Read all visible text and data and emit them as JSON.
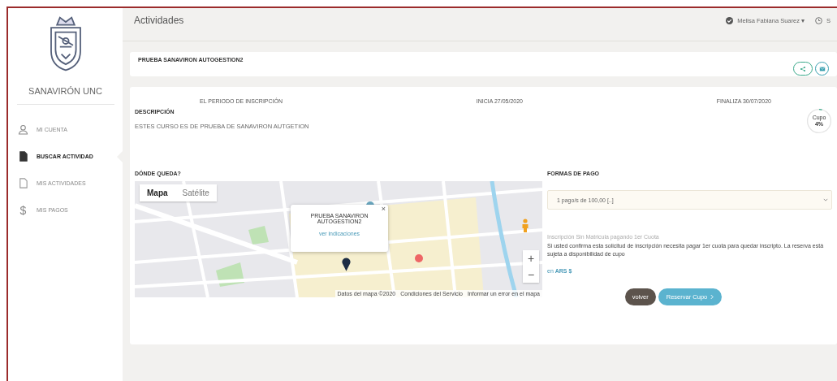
{
  "sidebar": {
    "brand": "SANAVIRÓN UNC",
    "items": [
      {
        "label": "MI CUENTA",
        "kind": "account",
        "selected": false
      },
      {
        "label": "BUSCAR ACTIVIDAD",
        "kind": "search",
        "selected": true
      },
      {
        "label": "MIS ACTIVIDADES",
        "kind": "activities",
        "selected": false
      },
      {
        "label": "MIS PAGOS",
        "kind": "payments",
        "symbol": "$",
        "selected": false
      }
    ]
  },
  "header": {
    "title": "Actividades",
    "user": "Melisa Fabiana Suarez",
    "user_caret": "▾",
    "logout": "S"
  },
  "course": {
    "title": "PRUEBA SANAVIRON AUTOGESTION2"
  },
  "details": {
    "period_label": "EL PERIODO DE INSCRIPCIÓN",
    "start": "INICIA 27/05/2020",
    "end": "FINALIZA 30/07/2020",
    "description_label": "DESCRIPCIÓN",
    "description": "ESTES CURSO ES DE PRUEBA DE SANAVIRON AUTGETION",
    "cupo": {
      "label": "Cupo",
      "value": "4%",
      "level": 0.04
    }
  },
  "location": {
    "label": "DÓNDE QUEDA?",
    "map_tabs": [
      {
        "label": "Mapa",
        "selected": true
      },
      {
        "label": "Satélite",
        "selected": false
      }
    ],
    "popup": {
      "title": "PRUEBA SANAVIRON AUTOGESTION2",
      "link": "ver indicaciones",
      "close": "×"
    },
    "zoom_in": "+",
    "zoom_out": "−",
    "attribution": [
      "Datos del mapa ©2020",
      "Condiciones del Servicio",
      "Informar un error en el mapa"
    ]
  },
  "payment": {
    "label": "FORMAS DE PAGO",
    "selected_option": "1 pago/s de 100,00 [..]",
    "note_title": "Inscripción Sin Matricula pagando 1er Cuota",
    "note": "Si usted confirma esta solicitud de inscripción necesita pagar 1er cuota para quedar inscripto. La reserva está sujeta a disponibilidad de cupo",
    "currency": "en **ARS $**"
  },
  "buttons": [
    {
      "label": "volver",
      "kind": "back"
    },
    {
      "label": "Reservar Cupo",
      "kind": "primary"
    }
  ]
}
